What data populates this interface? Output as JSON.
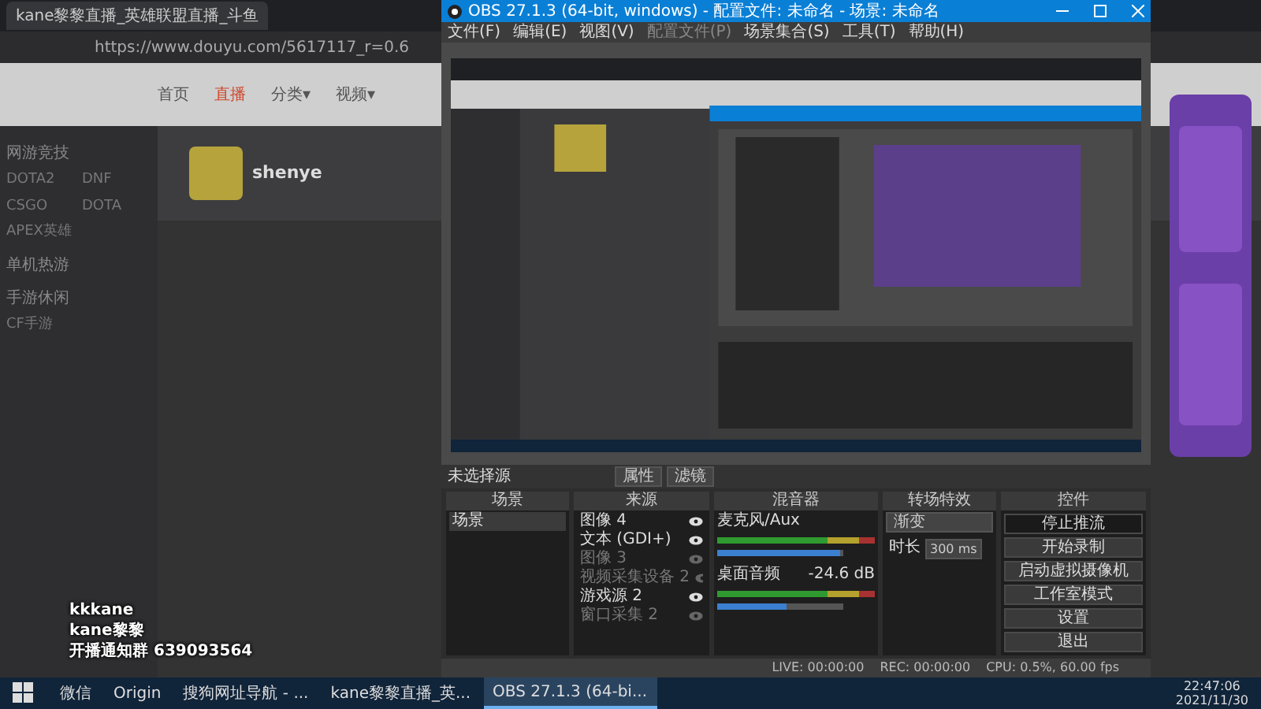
{
  "browser": {
    "tab_title": "kane黎黎直播_英雄联盟直播_斗鱼",
    "address": "https://www.douyu.com/5617117_r=0.6",
    "nav": [
      {
        "label": "首页",
        "selected": false
      },
      {
        "label": "直播",
        "selected": true
      },
      {
        "label": "分类▾",
        "selected": false
      },
      {
        "label": "视频▾",
        "selected": false
      }
    ],
    "streamer": "shenye",
    "sidebar": [
      {
        "heading": "网游竞技",
        "items": [
          "DOTA2",
          "DNF",
          "CSGO",
          "DOTA",
          "APEX英雄"
        ]
      },
      {
        "heading": "单机热游"
      },
      {
        "heading": "手游休闲",
        "items": [
          "CF手游"
        ]
      }
    ]
  },
  "overlay": [
    "kkkane",
    "kane黎黎",
    "开播通知群 639093564"
  ],
  "obs": {
    "title": "OBS 27.1.3 (64-bit, windows) - 配置文件: 未命名 - 场景: 未命名",
    "menu": [
      {
        "label": "文件(F)",
        "disabled": false
      },
      {
        "label": "编辑(E)",
        "disabled": false
      },
      {
        "label": "视图(V)",
        "disabled": false
      },
      {
        "label": "配置文件(P)",
        "disabled": true
      },
      {
        "label": "场景集合(S)",
        "disabled": false
      },
      {
        "label": "工具(T)",
        "disabled": false
      },
      {
        "label": "帮助(H)",
        "disabled": false
      }
    ],
    "preview": {
      "kind": "picture"
    },
    "source_bar": {
      "label": "未选择源",
      "buttons": [
        "属性",
        "滤镜"
      ]
    },
    "docks": {
      "scenes": "场景",
      "sources": "来源",
      "mixer": "混音器",
      "transitions": "转场特效",
      "controls": "控件"
    },
    "scenes": [
      {
        "name": "场景",
        "selected": true
      }
    ],
    "sources": [
      {
        "name": "图像 4",
        "visible": true
      },
      {
        "name": "文本 (GDI+)",
        "visible": true
      },
      {
        "name": "图像 3",
        "visible": false
      },
      {
        "name": "视频采集设备 2",
        "visible": false
      },
      {
        "name": "游戏源 2",
        "visible": true
      },
      {
        "name": "窗口采集 2",
        "visible": false
      }
    ],
    "mixer": [
      {
        "name": "麦克风/Aux",
        "level": 0.97
      },
      {
        "name": "桌面音频",
        "reading": "-24.6 dB",
        "level": 0.55
      }
    ],
    "transition": {
      "type": "渐变",
      "duration_label": "时长",
      "duration": "300 ms"
    },
    "controls": [
      {
        "label": "停止推流",
        "kind": "dropdown"
      },
      {
        "label": "开始录制",
        "kind": "button"
      },
      {
        "label": "启动虚拟摄像机",
        "kind": "button"
      },
      {
        "label": "工作室模式",
        "kind": "button"
      },
      {
        "label": "设置",
        "kind": "button"
      },
      {
        "label": "退出",
        "kind": "button"
      }
    ],
    "status": [
      "LIVE: 00:00:00",
      "REC: 00:00:00",
      "CPU: 0.5%, 60.00 fps"
    ]
  },
  "taskbar": {
    "items": [
      {
        "label": "微信",
        "selected": false
      },
      {
        "label": "Origin",
        "selected": false
      },
      {
        "label": "搜狗网址导航 - ...",
        "selected": false
      },
      {
        "label": "kane黎黎直播_英...",
        "selected": false
      },
      {
        "label": "OBS 27.1.3 (64-bi...",
        "selected": true
      }
    ],
    "time": "22:47:06",
    "date": "2021/11/30"
  }
}
